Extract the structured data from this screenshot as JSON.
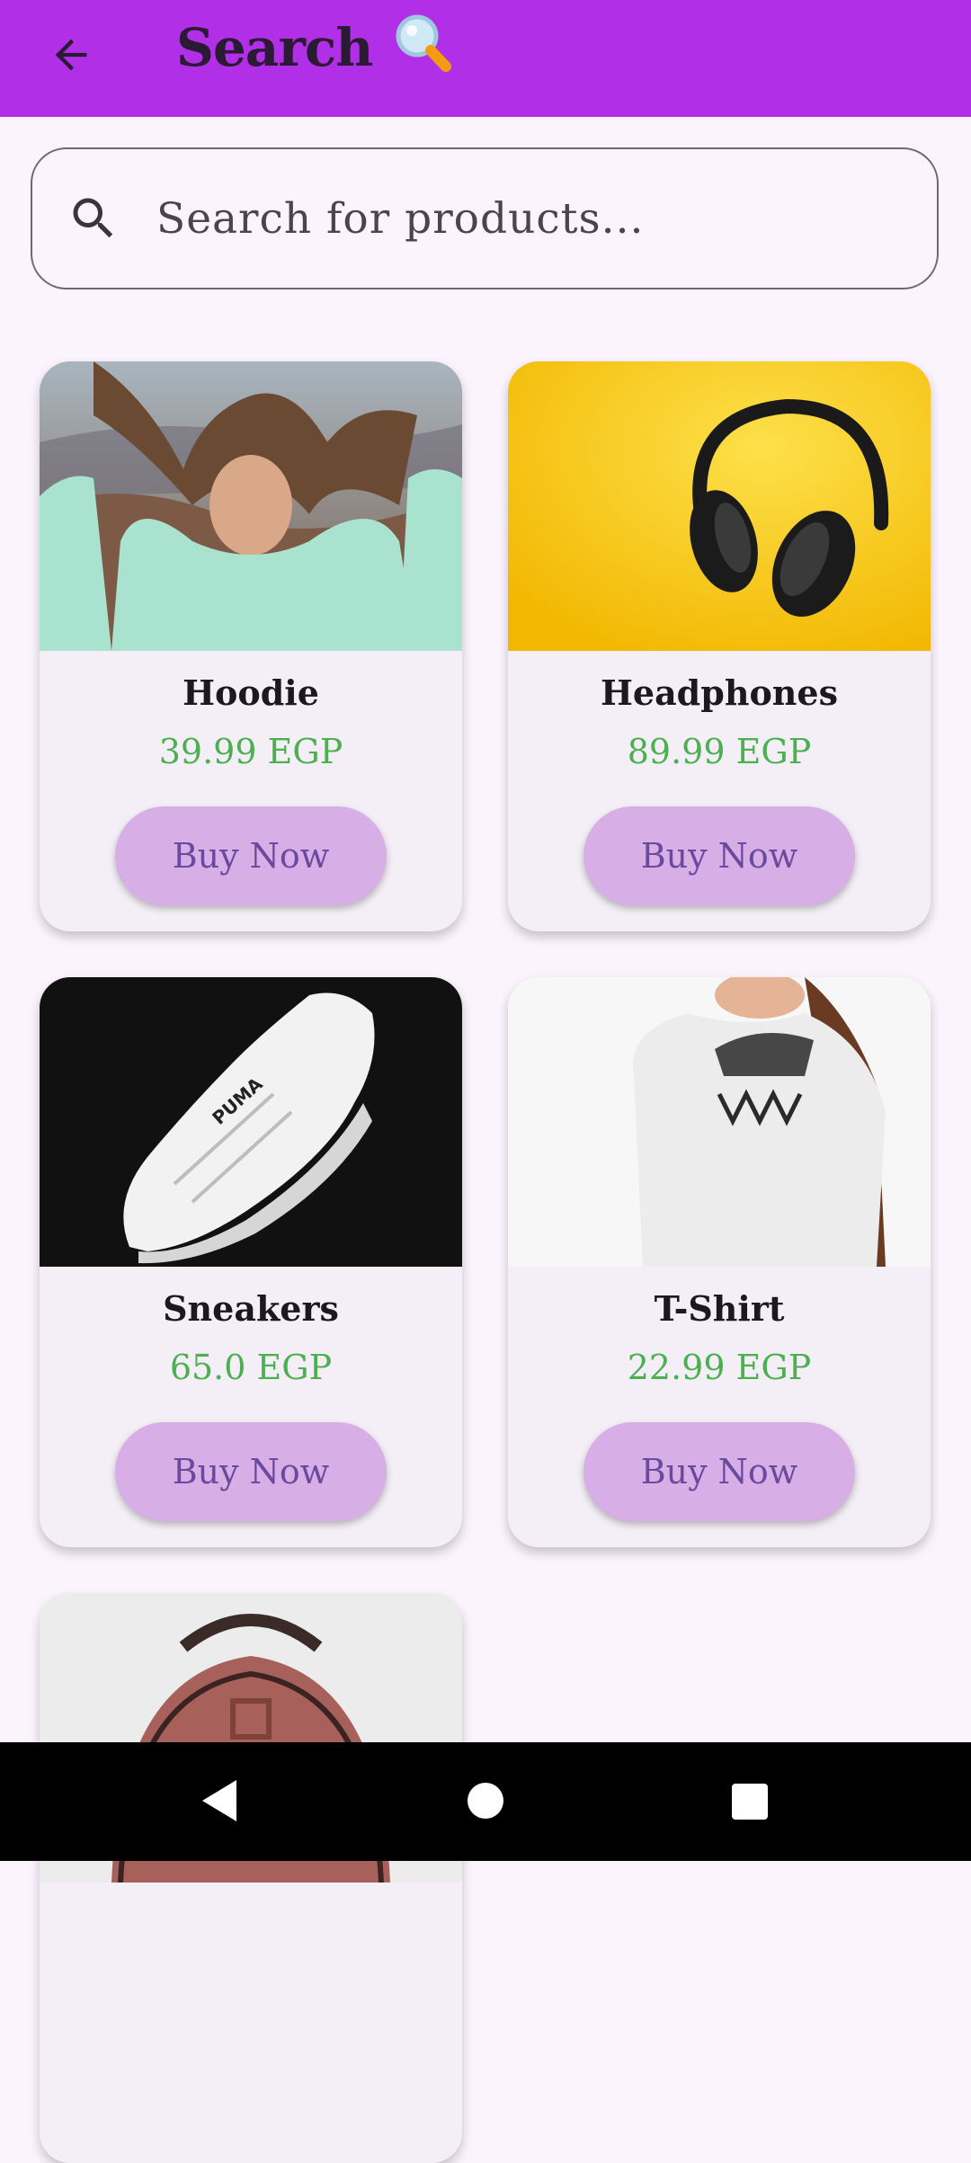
{
  "header": {
    "title": "Search",
    "title_emoji": "🔍"
  },
  "search": {
    "placeholder": "Search for products..."
  },
  "products": [
    {
      "name": "Hoodie",
      "price": "39.99 EGP",
      "button": "Buy Now"
    },
    {
      "name": "Headphones",
      "price": "89.99 EGP",
      "button": "Buy Now"
    },
    {
      "name": "Sneakers",
      "price": "65.0 EGP",
      "button": "Buy Now"
    },
    {
      "name": "T-Shirt",
      "price": "22.99 EGP",
      "button": "Buy Now"
    },
    {
      "name": "",
      "price": "",
      "button": ""
    }
  ],
  "colors": {
    "appbar": "#b22fe8",
    "background": "#fcf4fd",
    "card": "#f4eff6",
    "price": "#4caf50",
    "button": "#d7aee6",
    "button_text": "#6a4a9e"
  },
  "icons": {
    "back": "arrow-left-icon",
    "search": "search-icon",
    "nav_back": "triangle-back-icon",
    "nav_home": "circle-home-icon",
    "nav_recents": "square-recents-icon"
  }
}
